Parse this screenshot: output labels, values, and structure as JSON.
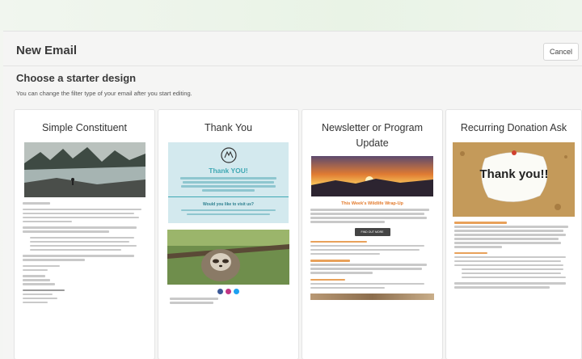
{
  "dialog": {
    "title": "New Email",
    "cancel_label": "Cancel"
  },
  "section": {
    "title": "Choose a starter design",
    "subtitle": "You can change the filter type of your email after you start editing."
  },
  "templates": [
    {
      "title": "Simple Constituent"
    },
    {
      "title": "Thank You",
      "banner_heading": "Thank YOU!",
      "sub_heading": "Would you like to visit us?"
    },
    {
      "title": "Newsletter or Program Update",
      "section_heading": "This Week's Wildlife Wrap-Up",
      "button_label": "FIND OUT MORE"
    },
    {
      "title": "Recurring Donation Ask",
      "note_text": "Thank you!!"
    }
  ],
  "colors": {
    "accent_teal": "#d3e9ee",
    "accent_orange": "#e37a2c",
    "sunset": "#f2a33a"
  },
  "icons": {
    "cancel": "close-icon",
    "social": "social-icons"
  }
}
